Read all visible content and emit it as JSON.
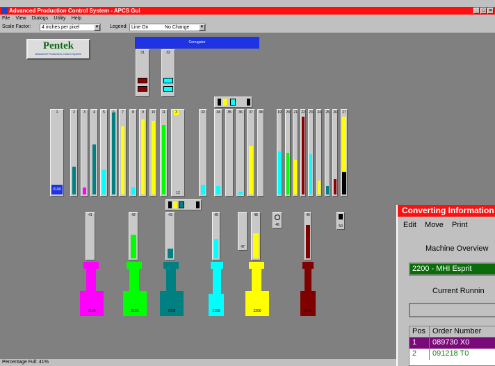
{
  "window": {
    "title": "Advanced Production Control System - APCS Gui",
    "controls": [
      "_",
      "□",
      "×"
    ]
  },
  "menu": [
    "File",
    "View",
    "Dialogs",
    "Utility",
    "Help"
  ],
  "toolbar": {
    "scale_label": "Scale Factor:",
    "scale_value": "4 inches per pixel",
    "legend_label": "Legend:",
    "legend_value": "Line On",
    "legend_value2": "No Change"
  },
  "logo": {
    "title": "Pentek",
    "subtitle": "Advanced Production Control System"
  },
  "corrugator": {
    "label": "Corrugator"
  },
  "columns": [
    {
      "id": "31"
    },
    {
      "id": "32"
    },
    {
      "id": "1"
    },
    {
      "id": "2"
    },
    {
      "id": "3"
    },
    {
      "id": "4"
    },
    {
      "id": "5"
    },
    {
      "id": "6"
    },
    {
      "id": "7"
    },
    {
      "id": "8"
    },
    {
      "id": "9"
    },
    {
      "id": "10"
    },
    {
      "id": "11"
    },
    {
      "id": "3"
    },
    {
      "id": "33"
    },
    {
      "id": "34"
    },
    {
      "id": "35"
    },
    {
      "id": "36"
    },
    {
      "id": "37"
    },
    {
      "id": "38"
    },
    {
      "id": "19"
    },
    {
      "id": "20"
    },
    {
      "id": "21"
    },
    {
      "id": "22"
    },
    {
      "id": "23"
    },
    {
      "id": "24"
    },
    {
      "id": "25"
    },
    {
      "id": "26"
    },
    {
      "id": "27"
    }
  ],
  "col1_readout": "0100",
  "col12_label": "12",
  "machines": [
    {
      "id": "41",
      "code": "2100",
      "color": "#ff00ff"
    },
    {
      "id": "42",
      "code": "2101",
      "color": "#00ff00"
    },
    {
      "id": "43",
      "code": "2002",
      "color": "#008080"
    },
    {
      "id": "45",
      "code": "2100",
      "color": "#00ffff"
    },
    {
      "id": "48",
      "code": "2200",
      "color": "#ffff00"
    },
    {
      "id": "49",
      "code": "1100",
      "color": "#800000"
    }
  ],
  "small_units": {
    "u47": "47",
    "u46": "46",
    "u50": "50"
  },
  "converting": {
    "title": "Converting Information",
    "menu": [
      "Edit",
      "Move",
      "Print"
    ],
    "overview_label": "Machine Overview",
    "selected_machine": "2200 - MHI Esprit",
    "running_label": "Current Runnin",
    "table_headers": [
      "Pos",
      "Order Number"
    ],
    "rows": [
      {
        "pos": "1",
        "order": "089730 X0"
      },
      {
        "pos": "2",
        "order": "091218 T0"
      }
    ]
  },
  "status": "Percentage Full: 41%"
}
